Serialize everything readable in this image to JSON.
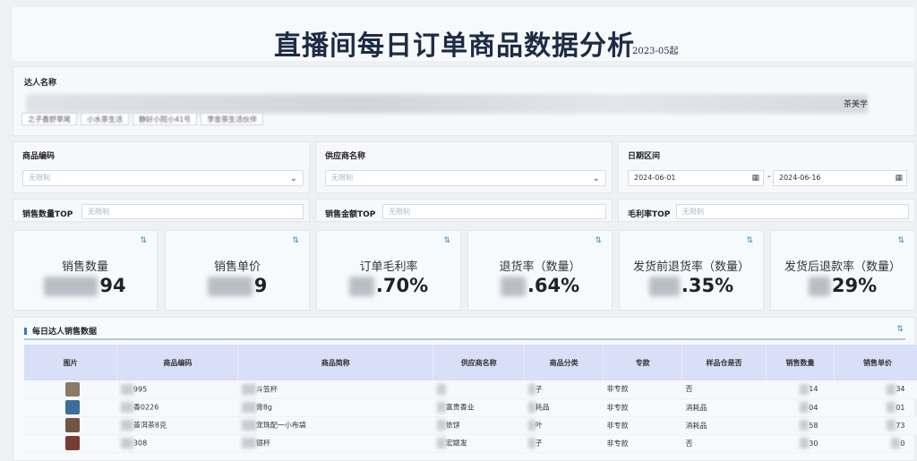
{
  "header": {
    "title": "直播间每日订单商品数据分析",
    "subtitle": "2023-05起"
  },
  "talent": {
    "label": "达人名称",
    "tail_tag": "茶美学",
    "chips": [
      "之子香舒草尾",
      "小水茶生活",
      "静好小院小41号",
      "李金茶生活伙伴"
    ]
  },
  "filters": {
    "product_code": {
      "label": "商品编码",
      "placeholder": "无限制"
    },
    "supplier": {
      "label": "供应商名称",
      "placeholder": "无限制"
    },
    "date_range": {
      "label": "日期区间",
      "start": "2024-06-01",
      "end": "2024-06-16",
      "separator": "-"
    }
  },
  "tops": {
    "sales_qty_top": {
      "label": "销售数量TOP",
      "placeholder": "无限制"
    },
    "sales_amount_top": {
      "label": "销售金额TOP",
      "placeholder": "无限制"
    },
    "margin_top": {
      "label": "毛利率TOP",
      "placeholder": "无限制"
    }
  },
  "kpis": [
    {
      "name": "销售数量",
      "value": "94"
    },
    {
      "name": "销售单价",
      "value": "9"
    },
    {
      "name": "订单毛利率",
      "value": ".70%"
    },
    {
      "name": "退货率（数量）",
      "value": ".64%"
    },
    {
      "name": "发货前退货率（数量）",
      "value": ".35%"
    },
    {
      "name": "发货后退款率（数量）",
      "value": "29%"
    }
  ],
  "table": {
    "title": "每日达人销售数据",
    "columns": [
      "图片",
      "商品编码",
      "商品简称",
      "供应商名称",
      "商品分类",
      "专款",
      "样品仓是否",
      "销售数量",
      "销售单价"
    ],
    "rows": [
      {
        "code": "995",
        "name": "斗笠杯",
        "supplier": "",
        "category": "子",
        "exclusive": "非专款",
        "sample": "否",
        "qty": "14",
        "price": "34",
        "thumb": "#8a7a66"
      },
      {
        "code": "香0226",
        "name": "膏8g",
        "supplier": "富贵香业",
        "category": "耗品",
        "exclusive": "非专款",
        "sample": "消耗品",
        "qty": "04",
        "price": "01",
        "thumb": "#3d6e9a"
      },
      {
        "code": "普洱茶8克",
        "name": "宠珠配一小布袋",
        "supplier": "依饼",
        "category": "叶",
        "exclusive": "非专款",
        "sample": "消耗品",
        "qty": "58",
        "price": "73",
        "thumb": "#6f5646"
      },
      {
        "code": "308",
        "name": "银杯",
        "supplier": "宏颛发",
        "category": "子",
        "exclusive": "非专款",
        "sample": "否",
        "qty": "30",
        "price": "0",
        "thumb": "#7a3c32"
      }
    ]
  }
}
